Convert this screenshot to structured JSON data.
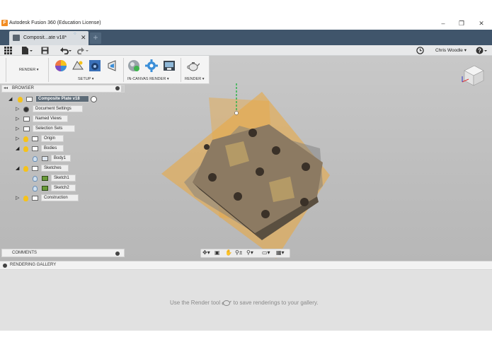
{
  "window": {
    "title": "Autodesk Fusion 360 (Education License)",
    "logo": "F",
    "minimize": "–",
    "maximize": "❐",
    "close": "✕"
  },
  "tabs": {
    "active_label": "Composit...ate v18*",
    "badge": "○",
    "close": "✕",
    "new": "+"
  },
  "quick_access": {
    "grid_icon": "grid-icon",
    "file_icon": "file-icon",
    "save_icon": "save-icon",
    "undo_icon": "undo-icon",
    "redo_icon": "redo-icon",
    "clock_icon": "clock-icon",
    "user": "Chris Woodle ▾",
    "help": "?▾"
  },
  "ribbon": {
    "workspace": "RENDER ▾",
    "setup_label": "SETUP ▾",
    "incanvas_label": "IN-CANVAS RENDER ▾",
    "render_label": "RENDER ▾"
  },
  "browser": {
    "title": "BROWSER",
    "collapse": "◂◂",
    "root": "Composite Plate v18",
    "items": [
      {
        "label": "Document Settings",
        "indent": 1
      },
      {
        "label": "Named Views",
        "indent": 1
      },
      {
        "label": "Selection Sets",
        "indent": 1
      },
      {
        "label": "Origin",
        "indent": 1
      },
      {
        "label": "Bodies",
        "indent": 1
      },
      {
        "label": "Body1",
        "indent": 2
      },
      {
        "label": "Sketches",
        "indent": 1
      },
      {
        "label": "Sketch1",
        "indent": 2
      },
      {
        "label": "Sketch2",
        "indent": 2
      },
      {
        "label": "Construction",
        "indent": 1
      }
    ]
  },
  "comments": {
    "label": "COMMENTS"
  },
  "gallery": {
    "title": "RENDERING GALLERY",
    "message_before": "Use the Render tool",
    "message_after": "to save renderings to your gallery."
  },
  "colors": {
    "tabstrip": "#40556b",
    "plane": "#e8a845",
    "plate": "#8c7a62",
    "accent": "#f28c22"
  }
}
